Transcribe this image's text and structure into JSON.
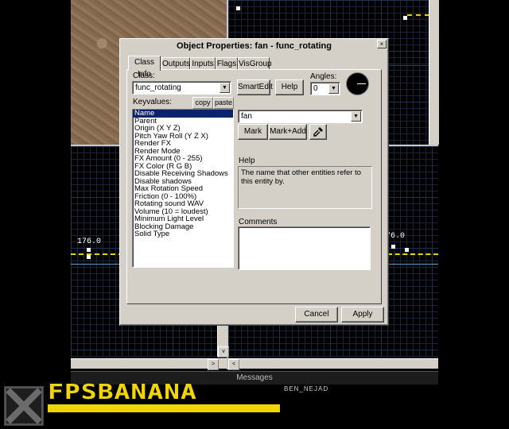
{
  "dialog": {
    "title": "Object Properties: fan - func_rotating",
    "close_label": "×",
    "tabs": [
      {
        "label": "Class Info",
        "active": true
      },
      {
        "label": "Outputs"
      },
      {
        "label": "Inputs"
      },
      {
        "label": "Flags"
      },
      {
        "label": "VisGroup"
      }
    ],
    "class_label": "Class:",
    "class_value": "func_rotating",
    "smartedit_label": "SmartEdit",
    "help_button_label": "Help",
    "angles_label": "Angles:",
    "angles_value": "0",
    "keyvalues_label": "Keyvalues:",
    "copy_label": "copy",
    "paste_label": "paste",
    "keyvalues": [
      "Name",
      "Parent",
      "Origin (X Y Z)",
      "Pitch Yaw Roll (Y Z X)",
      "Render FX",
      "Render Mode",
      "FX Amount (0 - 255)",
      "FX Color (R G B)",
      "Disable Receiving Shadows",
      "Disable shadows",
      "Max Rotation Speed",
      "Friction (0 - 100%)",
      "Rotating sound WAV",
      "Volume (10 = loudest)",
      "Minimum Light Level",
      "Blocking Damage",
      "Solid Type"
    ],
    "selected_keyvalue_index": 0,
    "value_field": "fan",
    "mark_label": "Mark",
    "mark_add_label": "Mark+Add",
    "help_label": "Help",
    "help_text": "The name that other entities refer to this entity by.",
    "comments_label": "Comments",
    "comments_text": "",
    "cancel_label": "Cancel",
    "apply_label": "Apply"
  },
  "editor": {
    "viewport_label_left": "176.0",
    "viewport_label_right": "76.0",
    "messages_label": "Messages",
    "scroll_left_arrow": "<",
    "scroll_right_arrow": ">",
    "scroll_down_arrow": "v"
  },
  "logo": {
    "text": "FPSBANANA",
    "author": "BEN_NEJAD"
  },
  "colors": {
    "window_face": "#d4d0c8",
    "selection": "#0a246a",
    "logo_yellow": "#f2d400",
    "grid": "#20324e"
  }
}
